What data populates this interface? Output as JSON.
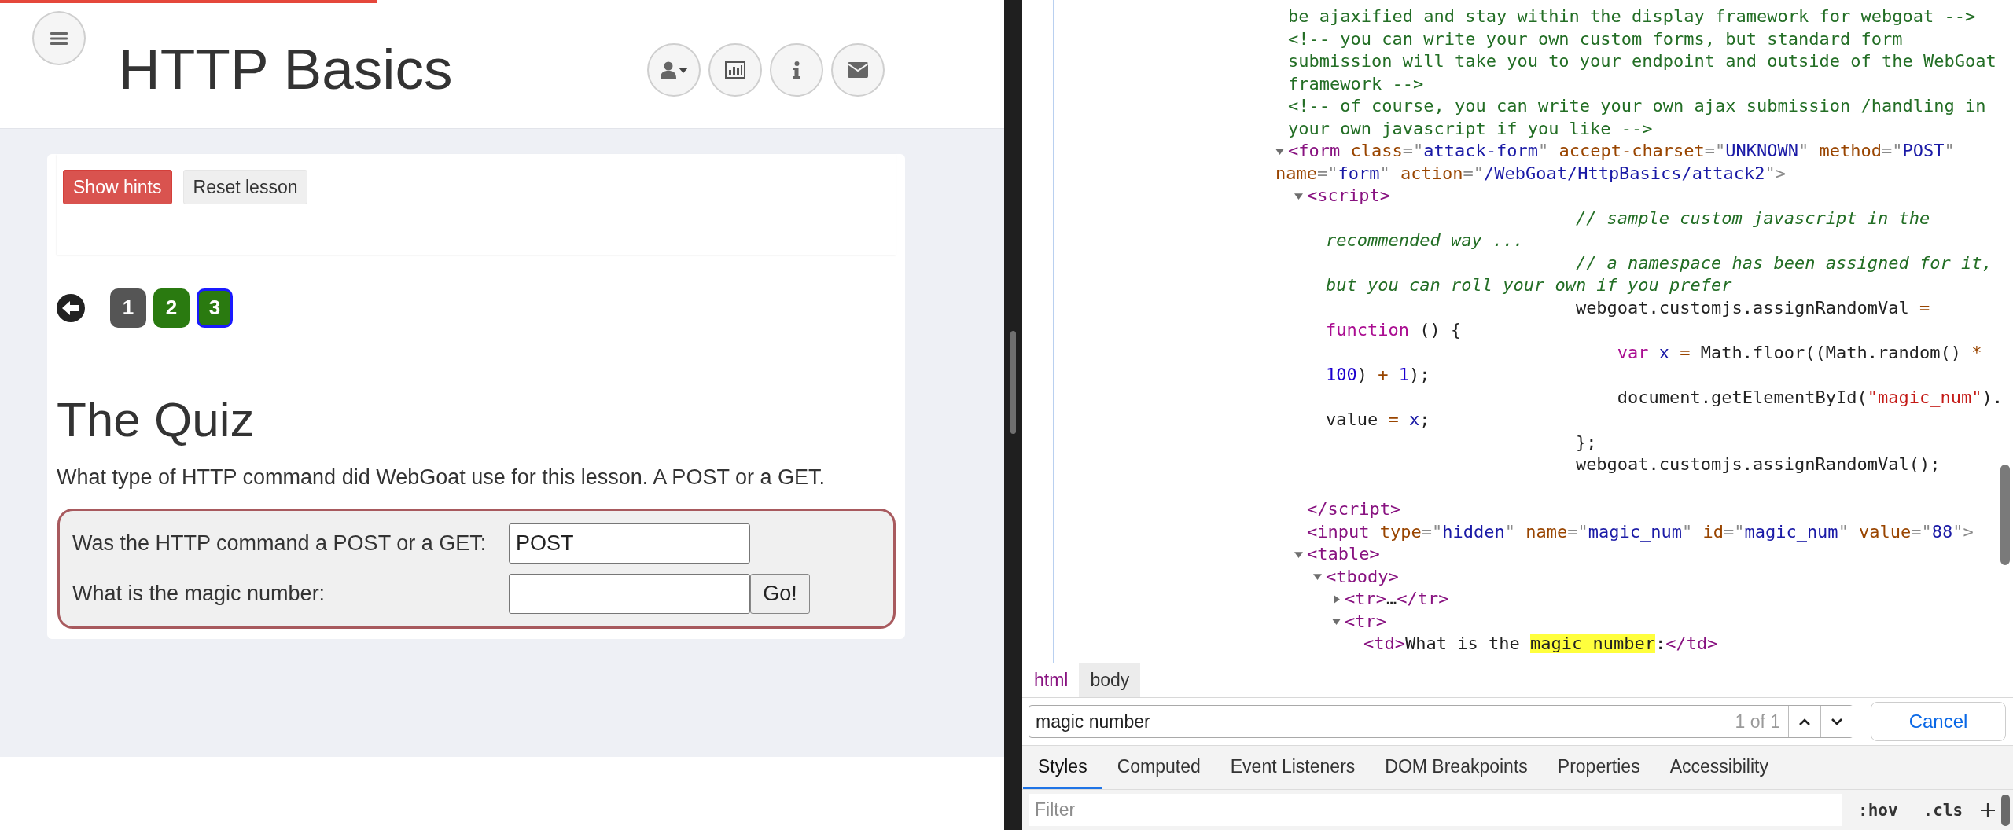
{
  "page": {
    "progress": {
      "level": 0.375
    },
    "header": {
      "title": "HTTP Basics"
    },
    "lesson_buttons": [
      {
        "label": "Show hints",
        "kind": "danger"
      },
      {
        "label": "Reset lesson",
        "kind": "default"
      }
    ],
    "pagination": [
      {
        "label": "1",
        "solved": false,
        "selected": false
      },
      {
        "label": "2",
        "solved": true,
        "selected": false
      },
      {
        "label": "3",
        "solved": true,
        "selected": true
      }
    ],
    "heading": "The Quiz",
    "description": "What type of HTTP command did WebGoat use for this lesson. A POST or a GET.",
    "form": {
      "rows": [
        {
          "label": "Was the HTTP command a POST or a GET:",
          "value": "POST"
        },
        {
          "label": "What is the magic number:",
          "value": "",
          "button": "Go!"
        }
      ]
    }
  },
  "devtools": {
    "dom_tree": [
      {
        "kind": "comment",
        "lines": [
          "be ajaxified and stay within the display framework for webgoat -->"
        ]
      },
      {
        "kind": "comment",
        "lines": [
          "<!-- you can write your own custom forms, but standard form",
          "submission will take you to your endpoint and outside of the WebGoat",
          "framework -->"
        ]
      },
      {
        "kind": "comment",
        "lines": [
          "<!-- of course, you can write your own ajax submission /handling in",
          "your own javascript if you like -->"
        ]
      },
      {
        "kind": "element",
        "expanded": true,
        "lines": [
          [
            {
              "kind": "tag",
              "text": "<form"
            },
            {
              "kind": "attr",
              "text": " class"
            },
            {
              "kind": "punct",
              "text": "=\""
            },
            {
              "kind": "value",
              "text": "attack-form"
            },
            {
              "kind": "punct",
              "text": "\""
            },
            {
              "kind": "attr",
              "text": " accept-charset"
            },
            {
              "kind": "punct",
              "text": "=\""
            },
            {
              "kind": "value",
              "text": "UNKNOWN"
            },
            {
              "kind": "punct",
              "text": "\""
            },
            {
              "kind": "attr",
              "text": " method"
            },
            {
              "kind": "punct",
              "text": "=\""
            },
            {
              "kind": "value",
              "text": "POST"
            },
            {
              "kind": "punct",
              "text": "\""
            }
          ],
          [
            {
              "kind": "attr",
              "text": "name"
            },
            {
              "kind": "punct",
              "text": "=\""
            },
            {
              "kind": "value",
              "text": "form"
            },
            {
              "kind": "punct",
              "text": "\""
            },
            {
              "kind": "attr",
              "text": " action"
            },
            {
              "kind": "punct",
              "text": "=\""
            },
            {
              "kind": "value",
              "text": "/WebGoat/HttpBasics/attack2"
            },
            {
              "kind": "punct",
              "text": "\">"
            }
          ]
        ],
        "children": [
          {
            "kind": "element",
            "expanded": true,
            "lines": [
              [
                {
                  "kind": "tag",
                  "text": "<script>"
                }
              ]
            ],
            "closing": [
              {
                "kind": "tag",
                "text": "</script>"
              }
            ],
            "children": [
              {
                "kind": "text",
                "lines": [
                  [
                    {
                      "kind": "jscomment",
                      "text": "                        // sample custom javascript in the"
                    }
                  ],
                  [
                    {
                      "kind": "jscomment",
                      "text": "recommended way ..."
                    }
                  ],
                  [
                    {
                      "kind": "jscomment",
                      "text": "                        // a namespace has been assigned for it,"
                    }
                  ],
                  [
                    {
                      "kind": "jscomment",
                      "text": "but you can roll your own if you prefer"
                    }
                  ],
                  [
                    {
                      "kind": "js",
                      "text": "                        webgoat.customjs.assignRandomVal "
                    },
                    {
                      "kind": "op",
                      "text": "="
                    }
                  ],
                  [
                    {
                      "kind": "kw",
                      "text": "function"
                    },
                    {
                      "kind": "js",
                      "text": " () {"
                    }
                  ],
                  [
                    {
                      "kind": "kw",
                      "text": "                            var"
                    },
                    {
                      "kind": "var",
                      "text": " x"
                    },
                    {
                      "kind": "op",
                      "text": " ="
                    },
                    {
                      "kind": "js",
                      "text": " Math.floor((Math.random() "
                    },
                    {
                      "kind": "op",
                      "text": "*"
                    }
                  ],
                  [
                    {
                      "kind": "num",
                      "text": "100"
                    },
                    {
                      "kind": "js",
                      "text": ") "
                    },
                    {
                      "kind": "op",
                      "text": "+"
                    },
                    {
                      "kind": "num",
                      "text": " 1"
                    },
                    {
                      "kind": "js",
                      "text": ");"
                    }
                  ],
                  [
                    {
                      "kind": "js",
                      "text": "                            document.getElementById("
                    },
                    {
                      "kind": "str",
                      "text": "\"magic_num\""
                    },
                    {
                      "kind": "js",
                      "text": ")."
                    }
                  ],
                  [
                    {
                      "kind": "js",
                      "text": "value "
                    },
                    {
                      "kind": "op",
                      "text": "="
                    },
                    {
                      "kind": "var",
                      "text": " x"
                    },
                    {
                      "kind": "js",
                      "text": ";"
                    }
                  ],
                  [
                    {
                      "kind": "js",
                      "text": "                        };"
                    }
                  ],
                  [
                    {
                      "kind": "js",
                      "text": "                        webgoat.customjs.assignRandomVal();"
                    }
                  ]
                ]
              }
            ]
          },
          {
            "kind": "element",
            "lines": [
              [
                {
                  "kind": "tag",
                  "text": "<input"
                },
                {
                  "kind": "attr",
                  "text": " type"
                },
                {
                  "kind": "punct",
                  "text": "=\""
                },
                {
                  "kind": "value",
                  "text": "hidden"
                },
                {
                  "kind": "punct",
                  "text": "\""
                },
                {
                  "kind": "attr",
                  "text": " name"
                },
                {
                  "kind": "punct",
                  "text": "=\""
                },
                {
                  "kind": "value",
                  "text": "magic_num"
                },
                {
                  "kind": "punct",
                  "text": "\""
                },
                {
                  "kind": "attr",
                  "text": " id"
                },
                {
                  "kind": "punct",
                  "text": "=\""
                },
                {
                  "kind": "value",
                  "text": "magic_num"
                },
                {
                  "kind": "punct",
                  "text": "\""
                },
                {
                  "kind": "attr",
                  "text": " value"
                },
                {
                  "kind": "punct",
                  "text": "=\""
                },
                {
                  "kind": "value",
                  "text": "88"
                },
                {
                  "kind": "punct",
                  "text": "\">"
                }
              ]
            ]
          },
          {
            "kind": "element",
            "expanded": true,
            "lines": [
              [
                {
                  "kind": "tag",
                  "text": "<table>"
                }
              ]
            ],
            "children": [
              {
                "kind": "element",
                "expanded": true,
                "lines": [
                  [
                    {
                      "kind": "tag",
                      "text": "<tbody>"
                    }
                  ]
                ],
                "children": [
                  {
                    "kind": "element",
                    "expanded": false,
                    "lines": [
                      [
                        {
                          "kind": "tag",
                          "text": "<tr>"
                        },
                        {
                          "kind": "text",
                          "text": "…"
                        },
                        {
                          "kind": "tag",
                          "text": "</tr>"
                        }
                      ]
                    ]
                  },
                  {
                    "kind": "element",
                    "expanded": true,
                    "lines": [
                      [
                        {
                          "kind": "tag",
                          "text": "<tr>"
                        }
                      ]
                    ],
                    "children": [
                      {
                        "kind": "element",
                        "lines": [
                          [
                            {
                              "kind": "tag",
                              "text": "<td>"
                            },
                            {
                              "kind": "text",
                              "text": "What is the "
                            },
                            {
                              "kind": "match",
                              "text": "magic number"
                            },
                            {
                              "kind": "text",
                              "text": ":"
                            },
                            {
                              "kind": "tag",
                              "text": "</td>"
                            }
                          ]
                        ]
                      }
                    ]
                  }
                ]
              }
            ]
          }
        ]
      }
    ],
    "breadcrumbs": [
      {
        "label": "html",
        "selected": false
      },
      {
        "label": "body",
        "selected": true
      }
    ],
    "search": {
      "value": "magic number",
      "count": "1 of 1",
      "cancel": "Cancel"
    },
    "tabs": [
      {
        "label": "Styles",
        "selected": true
      },
      {
        "label": "Computed",
        "selected": false
      },
      {
        "label": "Event Listeners",
        "selected": false
      },
      {
        "label": "DOM Breakpoints",
        "selected": false
      },
      {
        "label": "Properties",
        "selected": false
      },
      {
        "label": "Accessibility",
        "selected": false
      }
    ],
    "filter": {
      "placeholder": "Filter",
      "toggles": [
        ":hov",
        ".cls"
      ]
    }
  }
}
